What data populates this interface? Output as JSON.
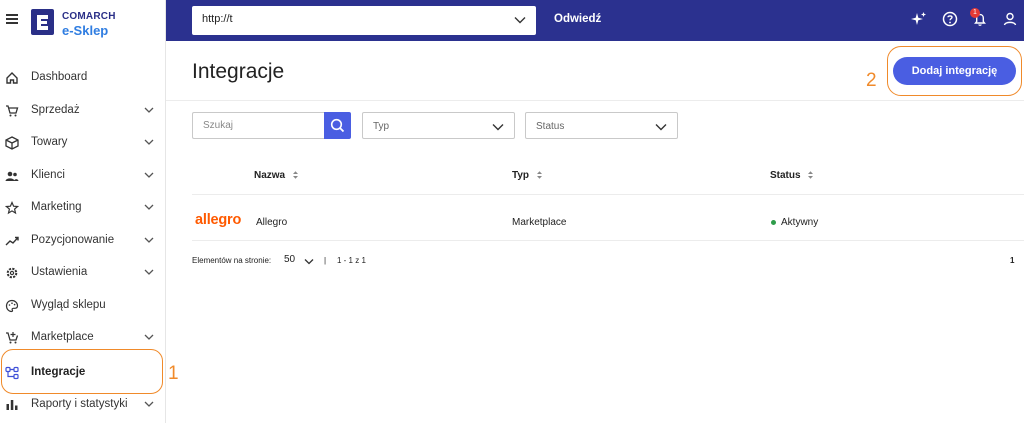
{
  "logo": {
    "line1": "COMARCH",
    "line2": "e-Sklep",
    "brand_color": "#2a2f87",
    "accent_color": "#2f7de1"
  },
  "sidebar": {
    "items": [
      {
        "label": "Dashboard",
        "icon": "home-icon",
        "expandable": false
      },
      {
        "label": "Sprzedaż",
        "icon": "cart-icon",
        "expandable": true
      },
      {
        "label": "Towary",
        "icon": "box-icon",
        "expandable": true
      },
      {
        "label": "Klienci",
        "icon": "users-icon",
        "expandable": true
      },
      {
        "label": "Marketing",
        "icon": "star-icon",
        "expandable": true
      },
      {
        "label": "Pozycjonowanie",
        "icon": "trend-icon",
        "expandable": true
      },
      {
        "label": "Ustawienia",
        "icon": "gear-icon",
        "expandable": true
      },
      {
        "label": "Wygląd sklepu",
        "icon": "palette-icon",
        "expandable": false
      },
      {
        "label": "Marketplace",
        "icon": "cart-plus-icon",
        "expandable": true
      },
      {
        "label": "Integracje",
        "icon": "integrations-icon",
        "expandable": false,
        "active": true
      },
      {
        "label": "Raporty i statystyki",
        "icon": "bar-chart-icon",
        "expandable": true
      }
    ]
  },
  "topbar": {
    "url_value": "http://t",
    "visit_label": "Odwiedź",
    "notifications_count": "1",
    "icons": [
      "sparkle-icon",
      "help-icon",
      "bell-icon",
      "user-icon"
    ],
    "bg_color": "#2b318f"
  },
  "main": {
    "title": "Integracje",
    "add_button_label": "Dodaj integrację",
    "search_placeholder": "Szukaj",
    "filter_type_placeholder": "Typ",
    "filter_status_placeholder": "Status",
    "columns": [
      "Nazwa",
      "Typ",
      "Status"
    ],
    "rows": [
      {
        "logo_text": "allegro",
        "name": "Allegro",
        "type": "Marketplace",
        "status": "Aktywny",
        "status_color": "#2e9c4a"
      }
    ],
    "pagination": {
      "per_page_label": "Elementów na stronie:",
      "per_page_value": "50",
      "separator": "|",
      "range": "1 - 1 z 1",
      "current_page": "1"
    },
    "accent_color": "#4a5ee2"
  },
  "annotations": {
    "sidebar_marker": "1",
    "button_marker": "2",
    "color": "#f08a2a"
  }
}
